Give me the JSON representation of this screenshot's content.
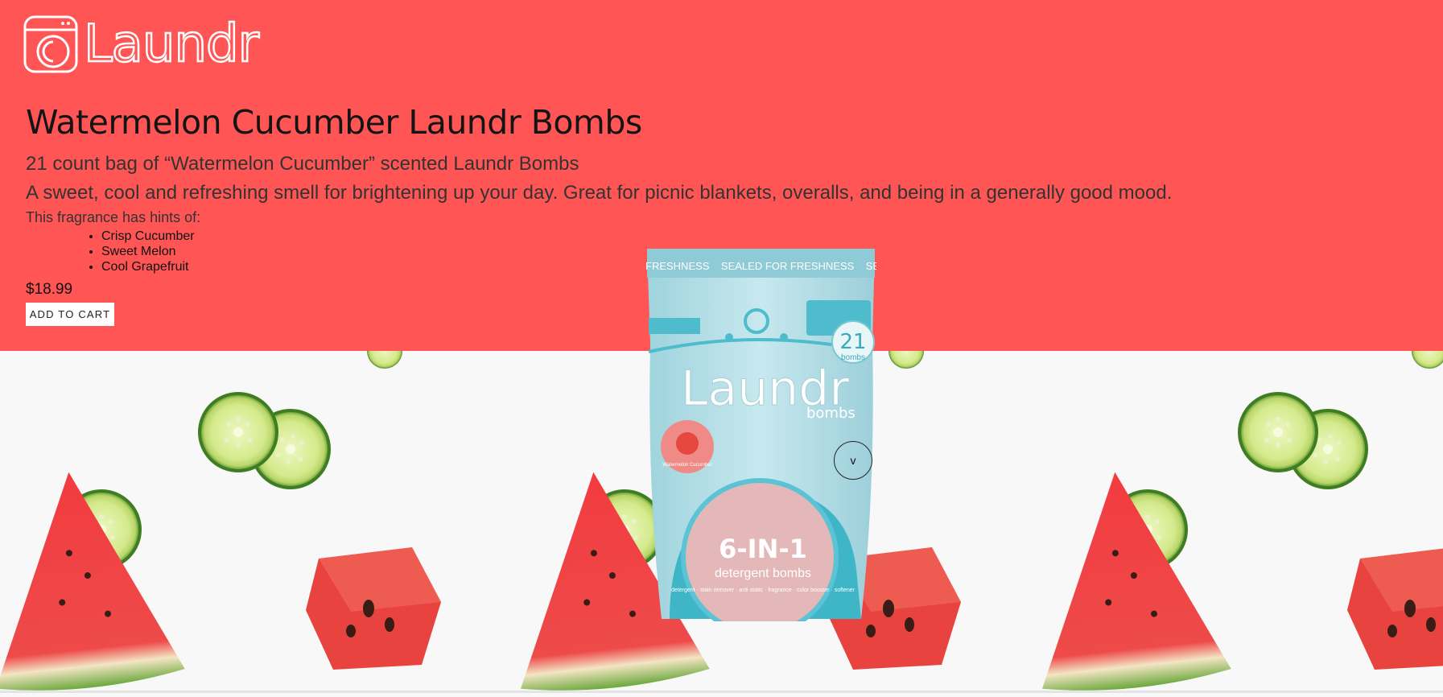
{
  "brand": {
    "name": "Laundr"
  },
  "product": {
    "title": "Watermelon Cucumber Laundr Bombs",
    "subtitle": "21 count bag of “Watermelon Cucumber” scented Laundr Bombs",
    "description": "A sweet, cool and refreshing smell for brightening up your day. Great for picnic blankets, overalls, and being in a generally good mood.",
    "hints_label": "This fragrance has hints of:",
    "notes": [
      "Crisp Cucumber",
      "Sweet Melon",
      "Cool Grapefruit"
    ],
    "price": "$18.99",
    "add_to_cart": "ADD TO CART"
  },
  "package": {
    "top_band": "FRESHNESS    SEALED FOR FRESHNESS    SEAL",
    "brand": "Laundr",
    "brand_sub": "bombs",
    "count": "21",
    "count_unit": "bombs",
    "flavor": "Watermelon Cucumber",
    "headline": "6-IN-1",
    "sub": "detergent bombs",
    "features": "detergent · stain remover · anti static · fragrance · color booster · softener"
  },
  "scroll": {
    "label": "v"
  },
  "colors": {
    "hero_bg": "#ff5555",
    "page_bg": "#f8f8f8",
    "package_teal": "#5cc3d4"
  }
}
